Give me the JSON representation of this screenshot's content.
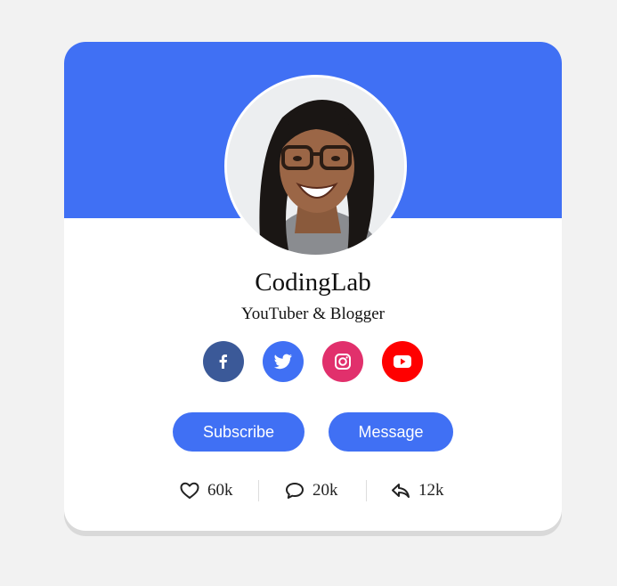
{
  "profile": {
    "name": "CodingLab",
    "job": "YouTuber & Blogger"
  },
  "social": [
    {
      "name": "facebook",
      "icon": "facebook-icon",
      "color": "#3b5998"
    },
    {
      "name": "twitter",
      "icon": "twitter-icon",
      "color": "#4070f4"
    },
    {
      "name": "instagram",
      "icon": "instagram-icon",
      "color": "#e1306c"
    },
    {
      "name": "youtube",
      "icon": "youtube-icon",
      "color": "#ff0000"
    }
  ],
  "buttons": {
    "subscribe": "Subscribe",
    "message": "Message"
  },
  "stats": {
    "likes": "60k",
    "comments": "20k",
    "shares": "12k"
  },
  "colors": {
    "accent": "#4070f4",
    "background": "#f2f2f2",
    "card": "#ffffff"
  }
}
